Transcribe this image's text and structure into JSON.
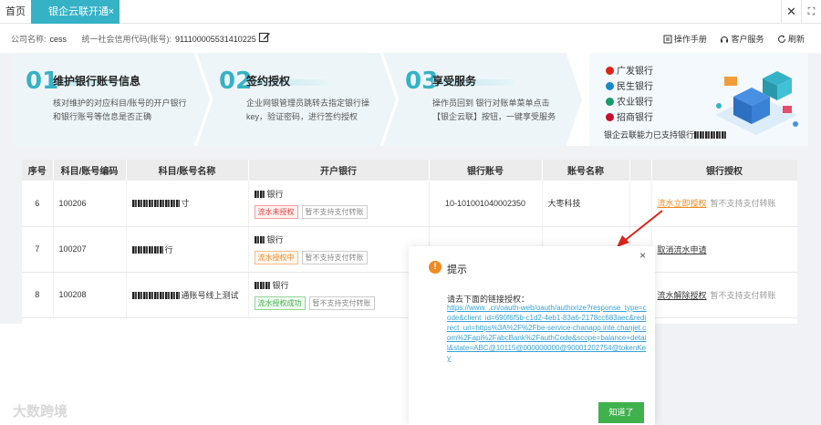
{
  "tabs": {
    "home": "首页",
    "active": "银企云联开通",
    "close_glyph": "×"
  },
  "window_controls": {
    "close": "✕",
    "fullscreen": "⛶"
  },
  "company": {
    "name_label": "公司名称:",
    "name_value": "cess",
    "code_label": "统一社会信用代码(账号):",
    "code_value": "911100005531410225"
  },
  "toolbar": {
    "manual": "操作手册",
    "service": "客户服务",
    "refresh": "刷新"
  },
  "steps": [
    {
      "num": "01",
      "title": "维护银行账号信息",
      "desc": "核对维护的对应科目/账号的开户银行和银行账号等信息是否正确"
    },
    {
      "num": "02",
      "title": "签约授权",
      "desc": "企业网银管理员跳转去指定银行操key，验证密码，进行签约授权"
    },
    {
      "num": "03",
      "title": "享受服务",
      "desc": "操作员回到 银行对账单菜单点击【银企云联】按钮，一键享受服务"
    }
  ],
  "banks": [
    {
      "name": "广发银行",
      "color": "#d9261c"
    },
    {
      "name": "民生银行",
      "color": "#1a8ac6"
    },
    {
      "name": "农业银行",
      "color": "#1c9b6a"
    },
    {
      "name": "招商银行",
      "color": "#c8102e"
    }
  ],
  "bank_footer_prefix": "银企云联能力已支持银行",
  "table": {
    "headers": [
      "序号",
      "科目/账号编码",
      "科目/账号名称",
      "开户银行",
      "银行账号",
      "账号名称",
      "",
      "银行授权"
    ],
    "rows": [
      {
        "seq": "6",
        "code": "100206",
        "name_suffix": "寸",
        "bank_suffix": "银行",
        "tag1": "流水未授权",
        "tag1_style": "red",
        "tag2": "暂不支持支付转账",
        "account": "10-101001040002350",
        "account_name": "大枣科技",
        "auth_link": "流水立即授权",
        "auth_link_style": "orange",
        "auth_note": "暂不支持支付转账"
      },
      {
        "seq": "7",
        "code": "100207",
        "name_suffix": "行",
        "bank_suffix": "银行",
        "tag1": "流水授权中",
        "tag1_style": "orange",
        "tag2": "暂不支持支付转账",
        "account": "",
        "account_name": "",
        "auth_link": "取消流水申请",
        "auth_link_style": "dark",
        "auth_note": ""
      },
      {
        "seq": "8",
        "code": "100208",
        "name_suffix": "通账号线上测试",
        "bank_suffix": "银行",
        "tag1": "流水授权成功",
        "tag1_style": "green",
        "tag2": "暂不支持支付转账",
        "account": "",
        "account_name": "",
        "auth_link": "流水解除授权",
        "auth_link_style": "dark",
        "auth_note": "暂不支持支付转账"
      }
    ]
  },
  "dialog": {
    "title": "提示",
    "icon": "!",
    "close": "×",
    "subtitle": "请去下面的链接授权：",
    "url": "https://www.                .cn/oauth-web/oauth/authorize?response_type=code&client_id=690f6f5b-c1d2-4eb1-83a6-2178cc683aec&redirect_uri=https%3A%2F%2Fbe-service-chanapp.inte.chanjet.com%2Fapi%2FabcBank%2FauthCode&scope=balance+detail&state=ABC@10115@000000000@90001202754@tokenKey",
    "ok": "知道了"
  },
  "watermark": "大数跨境"
}
